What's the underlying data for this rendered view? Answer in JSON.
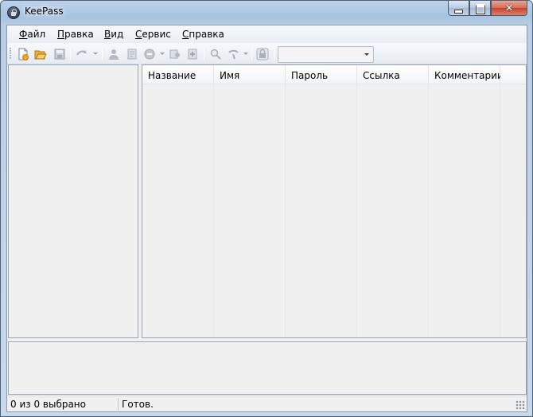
{
  "window": {
    "title": "KeePass"
  },
  "menu": {
    "items": [
      {
        "label_first": "Ф",
        "label_rest": "айл"
      },
      {
        "label_first": "П",
        "label_rest": "равка"
      },
      {
        "label_first": "В",
        "label_rest": "ид"
      },
      {
        "label_first": "С",
        "label_rest": "ервис"
      },
      {
        "label_first": "С",
        "label_rest": "правка"
      }
    ]
  },
  "toolbar": {
    "icons": [
      "new-database-icon",
      "open-database-icon",
      "save-icon",
      "sync-icon",
      "add-entry-icon",
      "edit-entry-icon",
      "delete-entry-icon",
      "copy-username-icon",
      "copy-password-icon",
      "find-icon",
      "filter-icon",
      "lock-icon"
    ],
    "search_value": ""
  },
  "entries": {
    "columns": [
      "Название",
      "Имя",
      "Пароль",
      "Ссылка",
      "Комментарии"
    ]
  },
  "status": {
    "selection": "0 из 0 выбрано",
    "state": "Готов."
  },
  "colors": {
    "accent": "#f5a623",
    "close_button": "#c3452a"
  }
}
